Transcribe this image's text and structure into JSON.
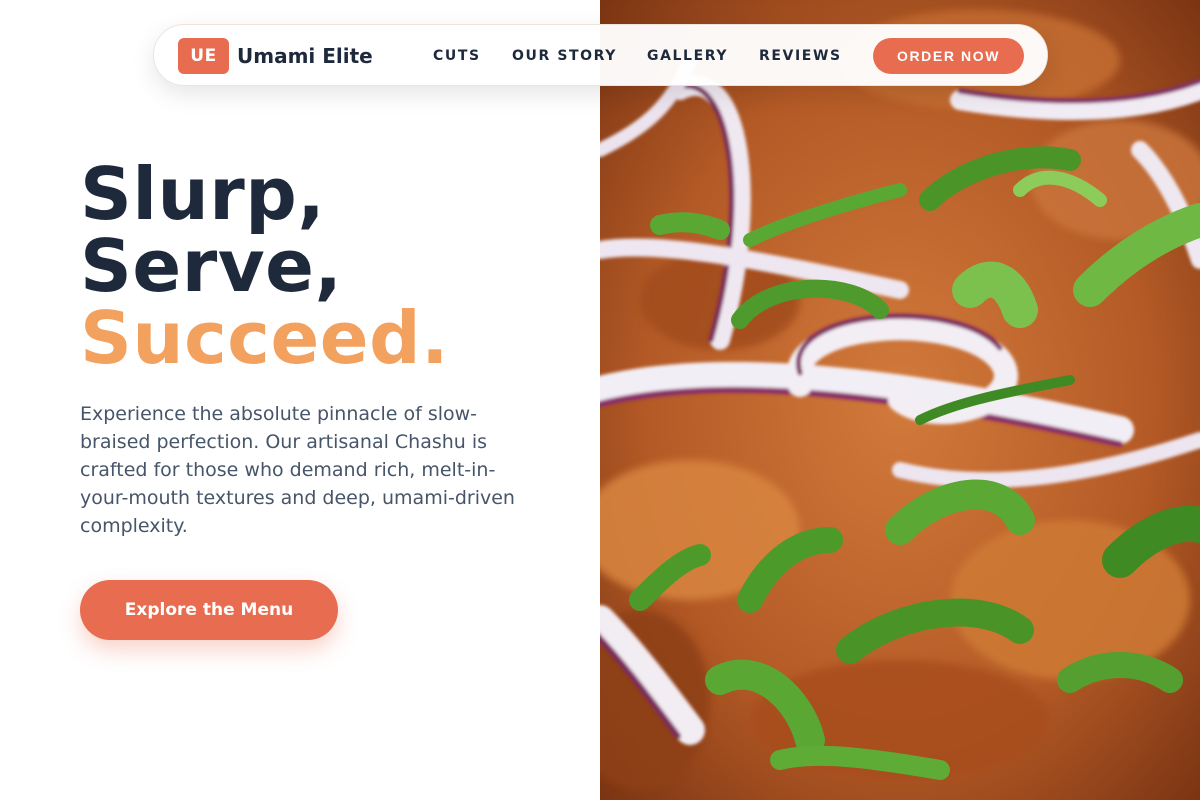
{
  "brand": {
    "badge": "UE",
    "name": "Umami Elite"
  },
  "nav": {
    "links": [
      "CUTS",
      "OUR STORY",
      "GALLERY",
      "REVIEWS"
    ],
    "order_button": "ORDER NOW"
  },
  "hero": {
    "headline": [
      "Slurp,",
      "Serve,",
      "Succeed."
    ],
    "intro": "Experience the absolute pinnacle of slow-braised perfection. Our artisanal Chashu is crafted for those who demand rich, melt-in-your-mouth textures and deep, umami-driven complexity.",
    "cta_label": "Explore the Menu",
    "image": "chashu-with-red-onion-and-scallions-photo"
  },
  "colors": {
    "accent": "#e86c50",
    "headline_highlight": "#f2a15f",
    "headline_dark": "#1e293b",
    "body_text": "#475569"
  }
}
